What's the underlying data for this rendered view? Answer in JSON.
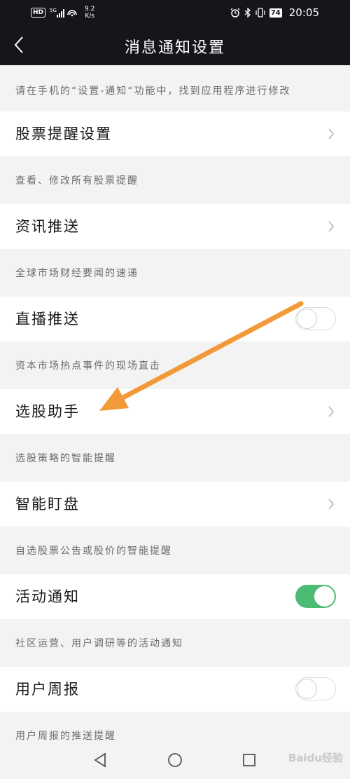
{
  "status_bar": {
    "network": "HD",
    "signal": "5G",
    "speed_value": "9.2",
    "speed_unit": "K/s",
    "battery": "74",
    "time": "20:05"
  },
  "nav": {
    "title": "消息通知设置"
  },
  "intro_note": "请在手机的“设置-通知“功能中，找到应用程序进行修改",
  "settings": [
    {
      "label": "股票提醒设置",
      "note": "查看、修改所有股票提醒",
      "control": "chevron"
    },
    {
      "label": "资讯推送",
      "note": "全球市场财经要闻的速递",
      "control": "chevron"
    },
    {
      "label": "直播推送",
      "note": "资本市场热点事件的现场直击",
      "control": "toggle",
      "enabled": false
    },
    {
      "label": "选股助手",
      "note": "选股策略的智能提醒",
      "control": "chevron"
    },
    {
      "label": "智能盯盘",
      "note": "自选股票公告或股价的智能提醒",
      "control": "chevron"
    },
    {
      "label": "活动通知",
      "note": "社区运营、用户调研等的活动通知",
      "control": "toggle",
      "enabled": true
    },
    {
      "label": "用户周报",
      "note": "用户周报的推送提醒",
      "control": "toggle",
      "enabled": false
    }
  ],
  "colors": {
    "header_bg": "#14161c",
    "toggle_on": "#4cbb73",
    "annotation_arrow": "#f29a3a"
  },
  "watermark": "Baidu经验"
}
